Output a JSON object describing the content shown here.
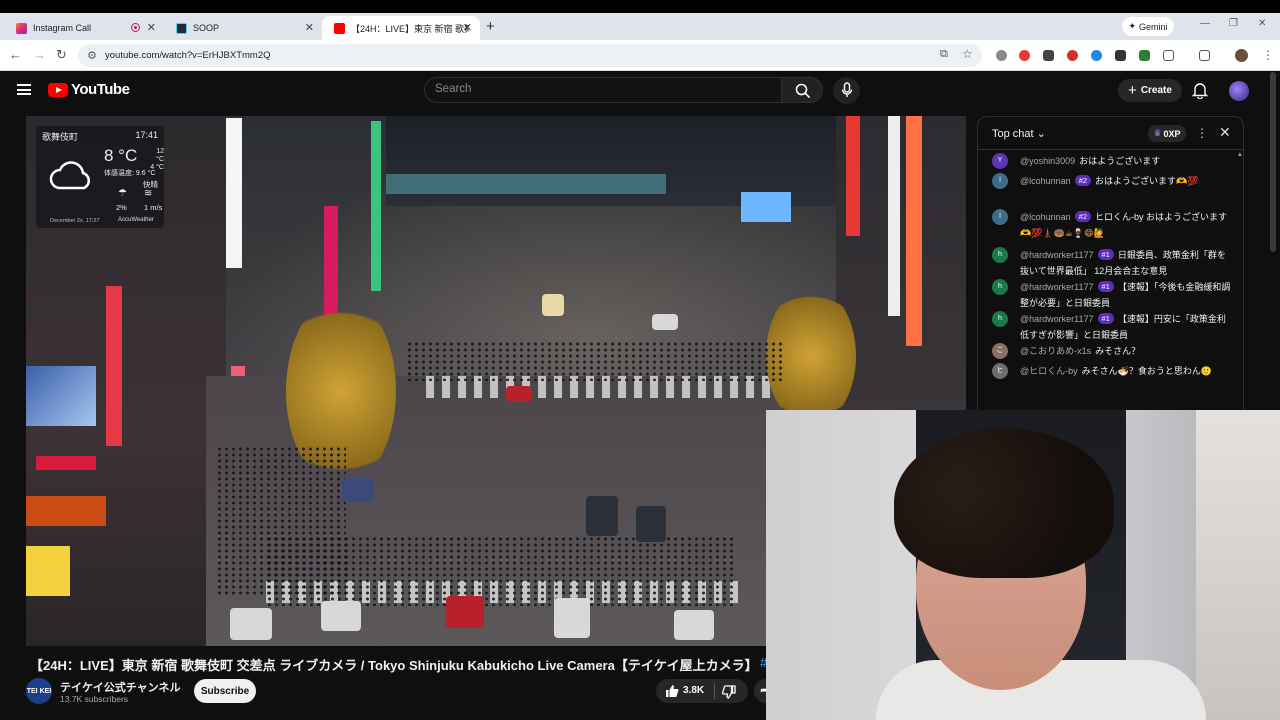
{
  "browser": {
    "tabs": [
      {
        "label": "Instagram Call",
        "color": "#e1306c"
      },
      {
        "label": "SOOP",
        "color": "#1f2937"
      },
      {
        "label": "【24H：LIVE】東京 新宿 歌舞伎",
        "color": "#ff0000"
      }
    ],
    "new_tab": "+",
    "gemini_label": "Gemini",
    "url": "youtube.com/watch?v=ErHJBXTmm2Q"
  },
  "youtube": {
    "logo_text": "YouTube",
    "search_placeholder": "Search",
    "create_label": "Create"
  },
  "video": {
    "weather": {
      "location": "歌舞伎町",
      "time": "17:41",
      "temp": "8 °C",
      "hi": "12 °C",
      "lo": "4 °C",
      "feels_like": "体感温度: 9.6 °C",
      "condition": "快晴",
      "rain": "2%",
      "wind": "1 m/s",
      "date": "December 2x, 17:27",
      "brand": "AccuWeather"
    },
    "title": "【24H：LIVE】東京 新宿 歌舞伎町 交差点 ライブカメラ / Tokyo Shinjuku Kabukicho Live Camera【テイケイ屋上カメラ】",
    "title_more": "#"
  },
  "channel": {
    "avatar_text": "TEI KEI",
    "name": "テイケイ公式チャンネル",
    "subscribers": "13.7K subscribers",
    "subscribe_label": "Subscribe",
    "likes": "3.8K"
  },
  "chat": {
    "header": "Top chat",
    "xp": "0XP",
    "messages": [
      {
        "avatar": "Y",
        "avatar_color": "#5e35b1",
        "user": "@yoshin3009",
        "badge": "",
        "text": "おはようございます",
        "emoji": ""
      },
      {
        "avatar": "l",
        "avatar_color": "#3f6b8a",
        "user": "@lcohunnan",
        "badge": "#2",
        "text": "おはようございます",
        "emoji": "🫶💯"
      },
      {
        "avatar": "l",
        "avatar_color": "#3f6b8a",
        "user": "@lcohunnan",
        "badge": "#2",
        "text": "ヒロくん-by おはようございます",
        "emoji": "🫶💯🗼🍩☕🍷😄🙋"
      },
      {
        "avatar": "h",
        "avatar_color": "#1b7a4a",
        "user": "@hardworker1177",
        "badge": "#1",
        "text": "日銀委員、政策金利「群を抜いて世界最低」 12月会合主な意見",
        "emoji": ""
      },
      {
        "avatar": "h",
        "avatar_color": "#1b7a4a",
        "user": "@hardworker1177",
        "badge": "#1",
        "text": "【速報】「今後も金融緩和調整が必要」と日銀委員",
        "emoji": ""
      },
      {
        "avatar": "h",
        "avatar_color": "#1b7a4a",
        "user": "@hardworker1177",
        "badge": "#1",
        "text": "【速報】円安に「政策金利低すぎが影響」と日銀委員",
        "emoji": ""
      },
      {
        "avatar": "こ",
        "avatar_color": "#8d6e63",
        "user": "@こおりあめ-x1s",
        "badge": "",
        "text": "みそさん？",
        "emoji": ""
      },
      {
        "avatar": "ヒ",
        "avatar_color": "#6d6d6d",
        "user": "@ヒロくん-by",
        "badge": "",
        "text": "みそさん🍜？食おうと思わん",
        "emoji": "🙂"
      }
    ]
  }
}
